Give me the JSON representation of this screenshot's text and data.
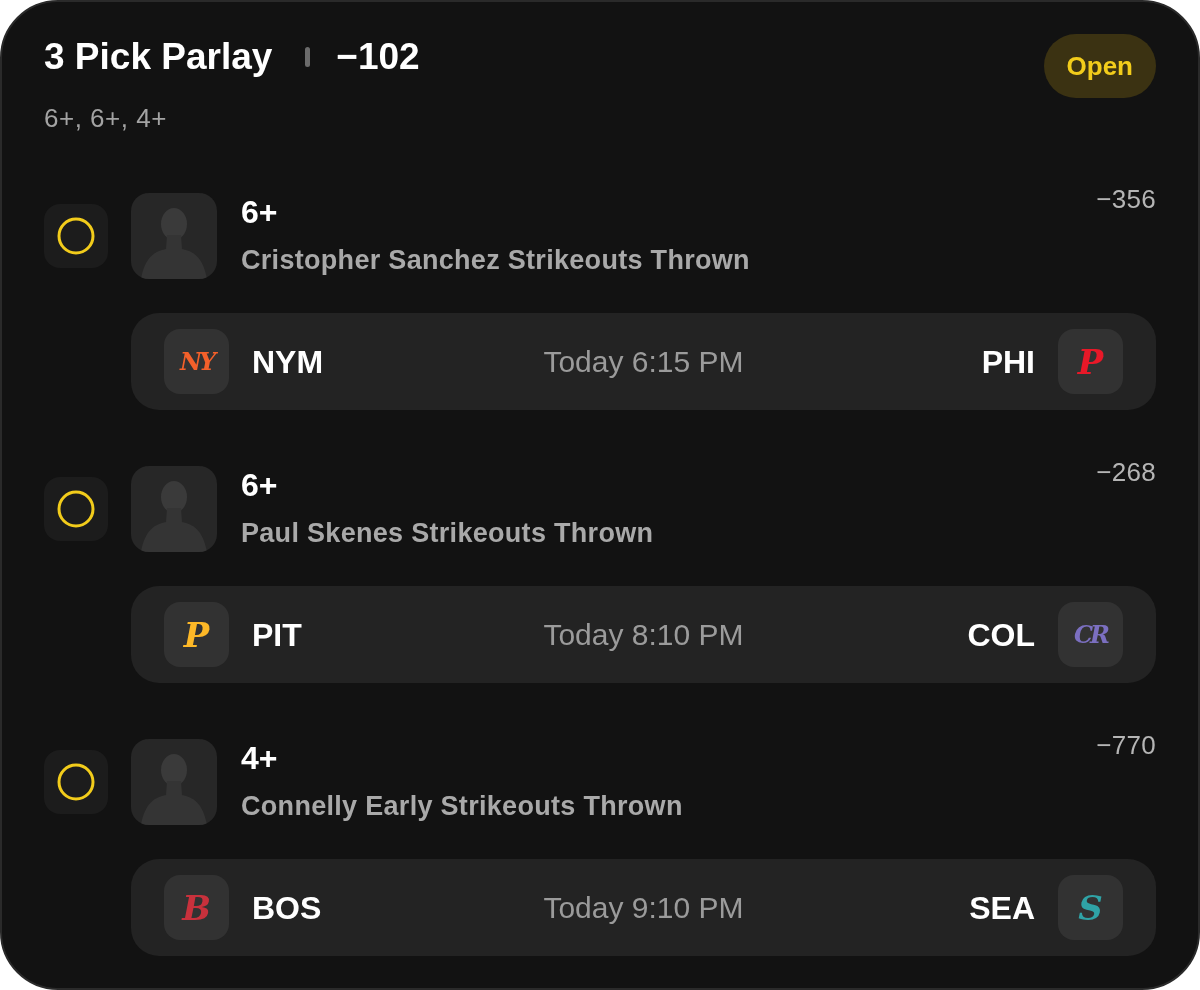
{
  "header": {
    "title": "3 Pick Parlay",
    "odds": "−102",
    "status": "Open",
    "summary": "6+, 6+, 4+"
  },
  "legs": [
    {
      "settled": false,
      "line": "6+",
      "market": "Cristopher Sanchez Strikeouts Thrown",
      "odds": "−356",
      "game": {
        "away": {
          "abbr": "NYM",
          "logo": "NY",
          "color": "#f4602a"
        },
        "time": "Today 6:15 PM",
        "home": {
          "abbr": "PHI",
          "logo": "P",
          "color": "#e81828"
        }
      }
    },
    {
      "settled": false,
      "line": "6+",
      "market": "Paul Skenes Strikeouts Thrown",
      "odds": "−268",
      "game": {
        "away": {
          "abbr": "PIT",
          "logo": "P",
          "color": "#fdb827"
        },
        "time": "Today 8:10 PM",
        "home": {
          "abbr": "COL",
          "logo": "CR",
          "color": "#7b6fc0"
        }
      }
    },
    {
      "settled": false,
      "line": "4+",
      "market": "Connelly Early Strikeouts Thrown",
      "odds": "−770",
      "game": {
        "away": {
          "abbr": "BOS",
          "logo": "B",
          "color": "#c8313c"
        },
        "time": "Today 9:10 PM",
        "home": {
          "abbr": "SEA",
          "logo": "S",
          "color": "#2fa3a6"
        }
      }
    }
  ]
}
